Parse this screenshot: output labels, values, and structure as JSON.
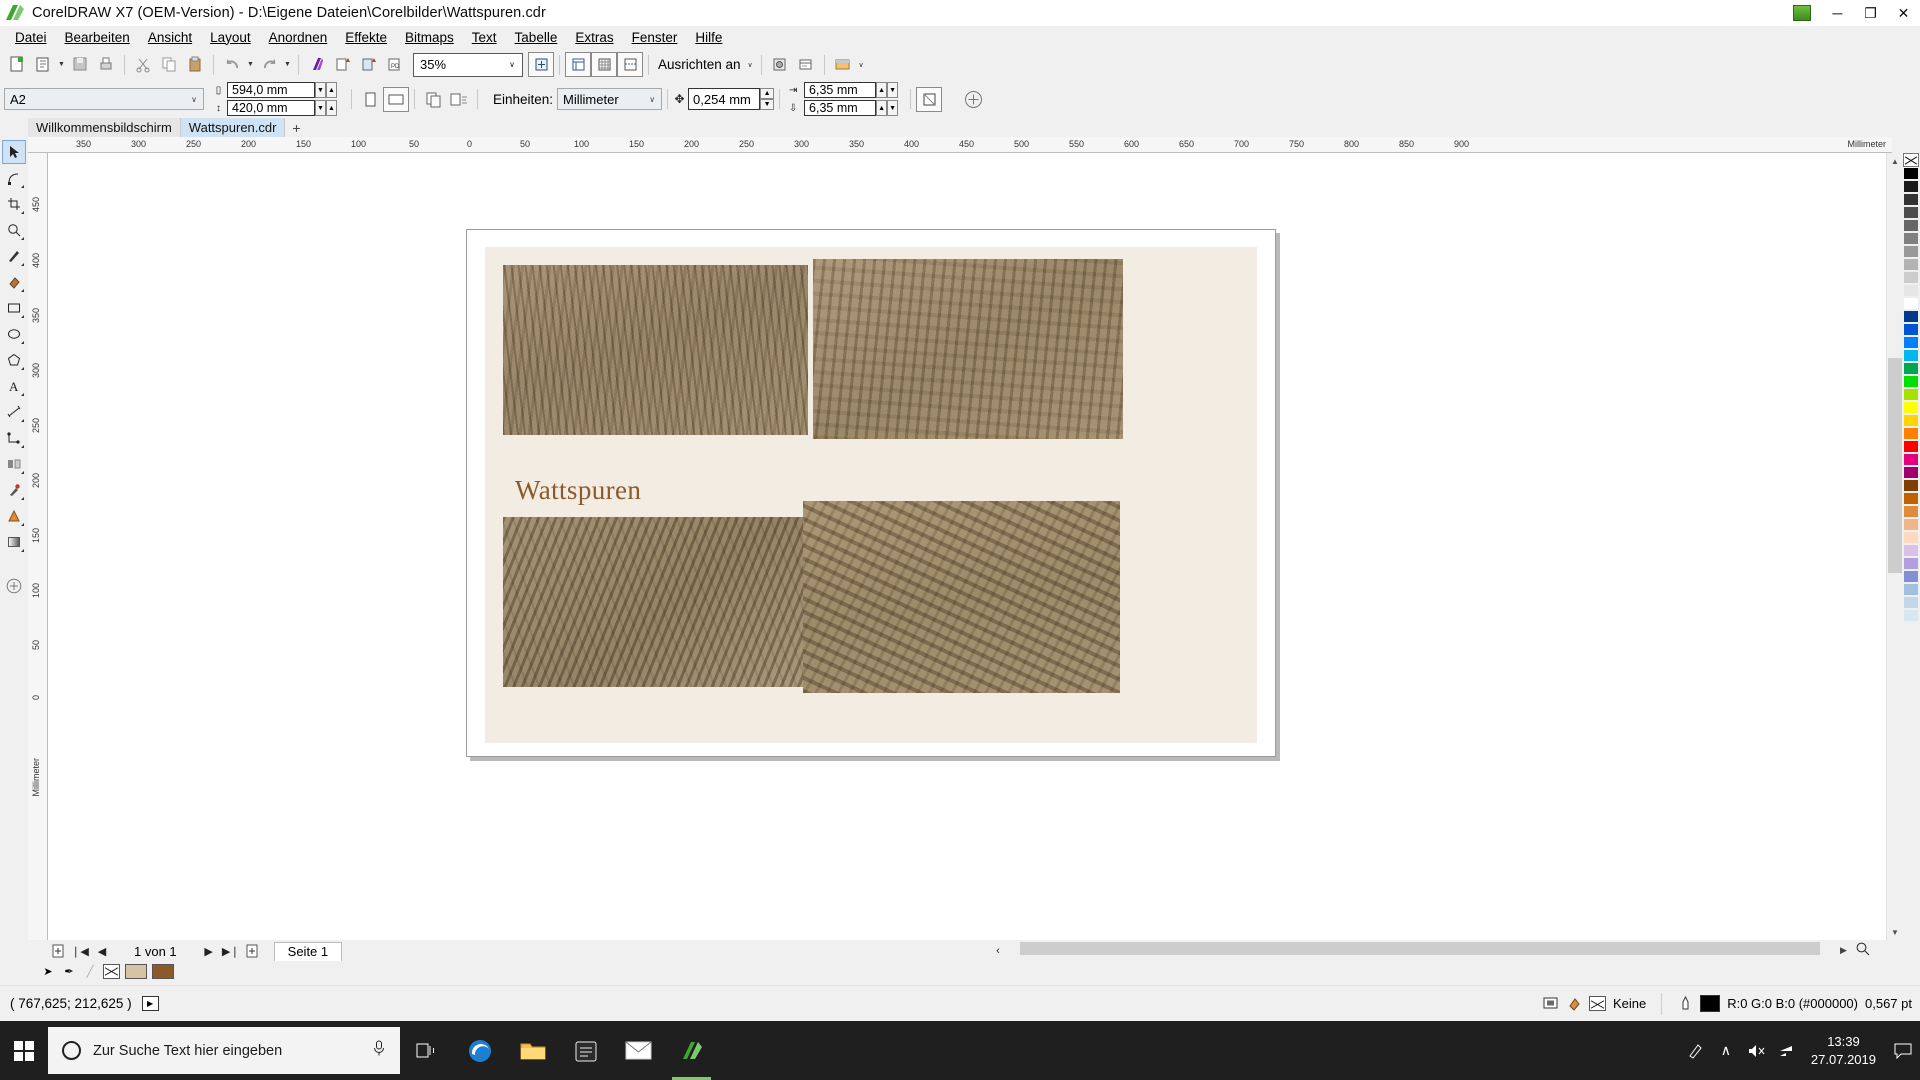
{
  "window": {
    "title": "CorelDRAW X7 (OEM-Version) - D:\\Eigene Dateien\\Corelbilder\\Wattspuren.cdr",
    "minimize": "─",
    "maximize": "❐",
    "close": "✕",
    "app_icon": "coreldraw-logo-icon"
  },
  "menu": [
    {
      "label": "Datei"
    },
    {
      "label": "Bearbeiten"
    },
    {
      "label": "Ansicht"
    },
    {
      "label": "Layout"
    },
    {
      "label": "Anordnen"
    },
    {
      "label": "Effekte"
    },
    {
      "label": "Bitmaps"
    },
    {
      "label": "Text"
    },
    {
      "label": "Tabelle"
    },
    {
      "label": "Extras"
    },
    {
      "label": "Fenster"
    },
    {
      "label": "Hilfe"
    }
  ],
  "toolbar": {
    "new_icon": "new-document-icon",
    "open_icon": "open-folder-icon",
    "save_icon": "save-disk-icon",
    "print_icon": "print-icon",
    "cut_icon": "scissors-icon",
    "copy_icon": "copy-icon",
    "paste_icon": "paste-clipboard-icon",
    "undo_icon": "undo-arrow-icon",
    "redo_icon": "redo-arrow-icon",
    "search_content_icon": "corel-connect-icon",
    "import_icon": "import-icon",
    "export_icon": "export-icon",
    "export_pdf_icon": "export-pdf-icon",
    "zoom_value": "35%",
    "zoom_caret": "∨",
    "fullscreen_icon": "zoom-levels-icon",
    "show_rulers_icon": "show-rulers-icon",
    "show_grid_icon": "show-grid-icon",
    "show_guides_icon": "show-guidelines-icon",
    "snap_label": "Ausrichten an",
    "snap_caret": "∨",
    "options_icon": "options-gear-icon",
    "launch_icon": "application-launcher-icon",
    "launch_caret": "∨"
  },
  "propertybar": {
    "page_size": "A2",
    "page_size_caret": "∨",
    "width_icon": "page-width-icon",
    "width_value": "594,0 mm",
    "height_icon": "page-height-icon",
    "height_value": "420,0 mm",
    "spin_up": "▲",
    "spin_down": "▼",
    "portrait_icon": "portrait-orientation-icon",
    "landscape_icon": "landscape-orientation-icon",
    "all_pages_icon": "apply-all-pages-icon",
    "current_page_icon": "apply-current-page-icon",
    "units_label": "Einheiten:",
    "units_value": "Millimeter",
    "units_caret": "∨",
    "nudge_icon": "nudge-offset-icon",
    "nudge_value": "0,254 mm",
    "duplicate_x_icon": "duplicate-distance-x-icon",
    "duplicate_x_value": "6,35 mm",
    "duplicate_y_icon": "duplicate-distance-y-icon",
    "duplicate_y_value": "6,35 mm",
    "edit_page_icon": "edit-page-icon",
    "add_icon": "add-more-icon"
  },
  "doctabs": {
    "tabs": [
      {
        "label": "Willkommensbildschirm",
        "active": false
      },
      {
        "label": "Wattspuren.cdr",
        "active": true
      }
    ],
    "add_label": "+"
  },
  "toolbox": [
    {
      "name": "pick-tool",
      "glyph": "➤",
      "selected": true
    },
    {
      "name": "shape-tool",
      "glyph": "◜",
      "selected": false
    },
    {
      "name": "crop-tool",
      "glyph": "✂",
      "selected": false
    },
    {
      "name": "zoom-tool",
      "glyph": "⚲",
      "selected": false
    },
    {
      "name": "freehand-tool",
      "glyph": "✒",
      "selected": false
    },
    {
      "name": "smart-fill-tool",
      "glyph": "❖",
      "selected": false
    },
    {
      "name": "rectangle-tool",
      "glyph": "▭",
      "selected": false
    },
    {
      "name": "ellipse-tool",
      "glyph": "◯",
      "selected": false
    },
    {
      "name": "polygon-tool",
      "glyph": "⬡",
      "selected": false
    },
    {
      "name": "text-tool",
      "glyph": "A",
      "selected": false
    },
    {
      "name": "parallel-dimension-tool",
      "glyph": "⤡",
      "selected": false
    },
    {
      "name": "straight-line-connector-tool",
      "glyph": "⊿",
      "selected": false
    },
    {
      "name": "blend-tool",
      "glyph": "◧",
      "selected": false
    },
    {
      "name": "color-eyedropper-tool",
      "glyph": "✐",
      "selected": false
    },
    {
      "name": "fill-tool",
      "glyph": "△",
      "selected": false
    },
    {
      "name": "interactive-fill-tool",
      "glyph": "▨",
      "selected": false
    },
    {
      "name": "quick-access-tool",
      "glyph": "⊕",
      "selected": false
    }
  ],
  "rulers": {
    "unit_label": "Millimeter",
    "vertical_unit_label": "Millimeter",
    "h_ticks": [
      "350",
      "300",
      "250",
      "200",
      "150",
      "100",
      "50",
      "0",
      "50",
      "100",
      "150",
      "200",
      "250",
      "300",
      "350",
      "400",
      "450",
      "500",
      "550",
      "600",
      "650",
      "700",
      "750",
      "800",
      "850",
      "900"
    ],
    "v_ticks": [
      "450",
      "400",
      "350",
      "300",
      "250",
      "200",
      "150",
      "100",
      "50",
      "0"
    ]
  },
  "document": {
    "heading": "Wattspuren",
    "heading_color": "#8a5a2b",
    "background_color": "#f2ece2",
    "photos": [
      {
        "name": "sand-ripples-top-left"
      },
      {
        "name": "sand-ripples-top-right"
      },
      {
        "name": "sand-ripples-bottom-left"
      },
      {
        "name": "sand-ripples-bottom-right"
      }
    ]
  },
  "pagenav": {
    "add_page_start_icon": "add-page-icon",
    "first_icon": "❘◀",
    "prev_icon": "◀",
    "count": "1 von 1",
    "next_icon": "▶",
    "last_icon": "▶❘",
    "add_page_end_icon": "add-page-icon",
    "page_tab": "Seite 1",
    "collapse_icon": "‹"
  },
  "colorrow": {
    "pick_icon": "pick-color-icon",
    "pen_icon": "outline-pen-icon",
    "none_swatch": "no-fill-icon",
    "swatch1": "#d8c2a4",
    "swatch2": "#8a5a2b"
  },
  "statusbar": {
    "coordinates": "( 767,625; 212,625 )",
    "play_icon": "▶",
    "screen_icon": "color-proof-icon",
    "fill_icon": "fill-bucket-icon",
    "fill_value": "Keine",
    "outline_icon": "outline-pen-icon",
    "outline_color_hex": "#000000",
    "outline_value": "R:0 G:0 B:0 (#000000)",
    "outline_width": "0,567 pt",
    "font_icon": "font-icon"
  },
  "taskbar": {
    "start_icon": "windows-start-icon",
    "search_placeholder": "Zur Suche Text hier eingeben",
    "cortana_icon": "cortana-circle-icon",
    "mic_icon": "microphone-icon",
    "taskview_icon": "task-view-icon",
    "items": [
      {
        "name": "edge-browser-icon",
        "active": false
      },
      {
        "name": "file-explorer-icon",
        "active": false
      },
      {
        "name": "microsoft-store-icon",
        "active": false
      },
      {
        "name": "mail-icon",
        "active": false
      },
      {
        "name": "coreldraw-icon",
        "active": true
      }
    ],
    "tray": {
      "pen_icon": "pen-workspace-icon",
      "chevron_icon": "∧",
      "volume_icon": "volume-muted-icon",
      "network_icon": "network-icon",
      "time": "13:39",
      "date": "27.07.2019",
      "action_center_icon": "action-center-icon"
    }
  }
}
